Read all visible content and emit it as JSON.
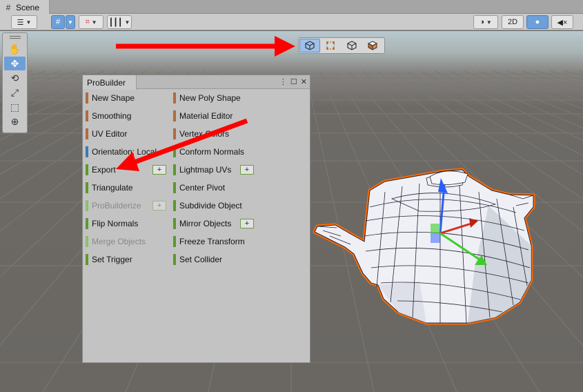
{
  "tabs": {
    "scene": "Scene"
  },
  "toolbar": {
    "mode_2d": "2D"
  },
  "selection_modes": [
    "object-mode",
    "vertex-mode",
    "edge-mode",
    "face-mode"
  ],
  "probuilder": {
    "title": "ProBuilder",
    "left": [
      {
        "label": "New Shape",
        "color": "#b26a3c",
        "disabled": false
      },
      {
        "label": "Smoothing",
        "color": "#b26a3c",
        "disabled": false
      },
      {
        "label": "UV Editor",
        "color": "#b26a3c",
        "disabled": false
      },
      {
        "label": "Orientation: Local",
        "color": "#3c7ab2",
        "disabled": false
      },
      {
        "label": "Export",
        "color": "#5a9a2e",
        "disabled": false,
        "plus": true
      },
      {
        "label": "Triangulate",
        "color": "#5a9a2e",
        "disabled": false
      },
      {
        "label": "ProBuilderize",
        "color": "#8cbf6a",
        "disabled": true,
        "plus": true
      },
      {
        "label": "Flip Normals",
        "color": "#5a9a2e",
        "disabled": false
      },
      {
        "label": "Merge Objects",
        "color": "#8cbf6a",
        "disabled": true
      },
      {
        "label": "Set Trigger",
        "color": "#5a9a2e",
        "disabled": false
      }
    ],
    "right": [
      {
        "label": "New Poly Shape",
        "color": "#b26a3c",
        "disabled": false
      },
      {
        "label": "Material Editor",
        "color": "#b26a3c",
        "disabled": false
      },
      {
        "label": "Vertex Colors",
        "color": "#b26a3c",
        "disabled": false
      },
      {
        "label": "Conform Normals",
        "color": "#5a9a2e",
        "disabled": false
      },
      {
        "label": "Lightmap UVs",
        "color": "#5a9a2e",
        "disabled": false,
        "plus": true
      },
      {
        "label": "Center Pivot",
        "color": "#5a9a2e",
        "disabled": false
      },
      {
        "label": "Subdivide Object",
        "color": "#5a9a2e",
        "disabled": false
      },
      {
        "label": "Mirror Objects",
        "color": "#5a9a2e",
        "disabled": false,
        "plus": true
      },
      {
        "label": "Freeze Transform",
        "color": "#5a9a2e",
        "disabled": false
      },
      {
        "label": "Set Collider",
        "color": "#5a9a2e",
        "disabled": false
      }
    ],
    "plus_label": "+"
  },
  "colors": {
    "accent": "#6d9fd8",
    "annotation": "#ff0000",
    "selection_outline": "#ff6a00"
  }
}
